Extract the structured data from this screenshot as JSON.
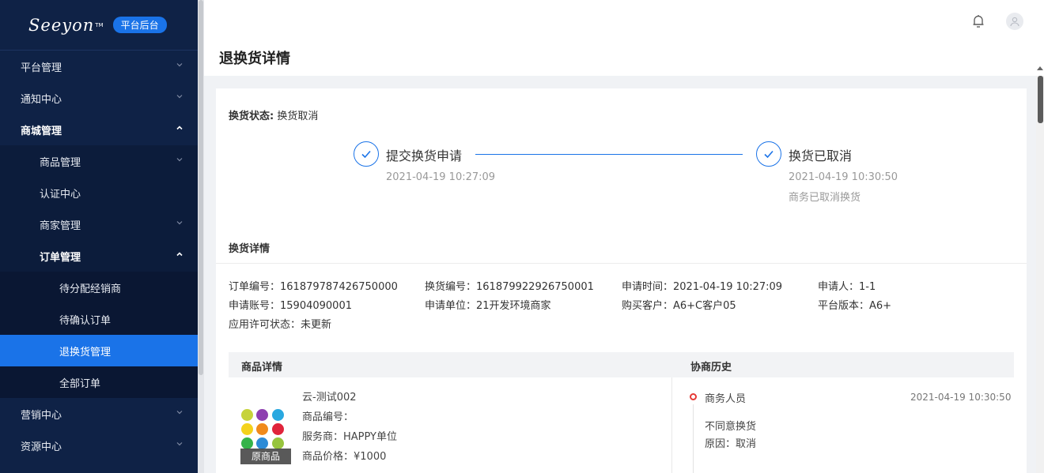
{
  "sidebar": {
    "logo": "Seeyon",
    "logo_tm": "TM",
    "badge": "平台后台",
    "items": [
      {
        "label": "平台管理"
      },
      {
        "label": "通知中心"
      },
      {
        "label": "商城管理"
      },
      {
        "label": "商品管理"
      },
      {
        "label": "认证中心"
      },
      {
        "label": "商家管理"
      },
      {
        "label": "订单管理"
      },
      {
        "label": "待分配经销商"
      },
      {
        "label": "待确认订单"
      },
      {
        "label": "退换货管理"
      },
      {
        "label": "全部订单"
      },
      {
        "label": "营销中心"
      },
      {
        "label": "资源中心"
      }
    ]
  },
  "header": {
    "title": "退换货详情",
    "icons": [
      "bell-icon",
      "user-icon"
    ]
  },
  "status": {
    "label": "换货状态:",
    "value": "换货取消"
  },
  "steps": [
    {
      "title": "提交换货申请",
      "time": "2021-04-19 10:27:09"
    },
    {
      "title": "换货已取消",
      "time": "2021-04-19 10:30:50",
      "note": "商务已取消换货"
    }
  ],
  "details": {
    "title": "换货详情",
    "fields": [
      "订单编号：161879787426750000",
      "换货编号：161879922926750001",
      "申请时间：2021-04-19 10:27:09",
      "申请人：1-1",
      "申请账号：15904090001",
      "申请单位：21开发环境商家",
      "购买客户：A6+C客户05",
      "平台版本：A6+",
      "应用许可状态：未更新"
    ]
  },
  "table": {
    "product_header": "商品详情",
    "history_header": "协商历史",
    "image_label": "原商品",
    "product": [
      "云-测试002",
      "商品编号：",
      "服务商：HAPPY单位",
      "商品价格：¥1000"
    ],
    "history": {
      "role": "商务人员",
      "time": "2021-04-19 10:30:50",
      "action": "不同意换货",
      "reason": "原因：取消"
    }
  },
  "colors": {
    "sidebar": "#0f2246",
    "accent": "#1a73e8",
    "danger": "#e53935"
  }
}
